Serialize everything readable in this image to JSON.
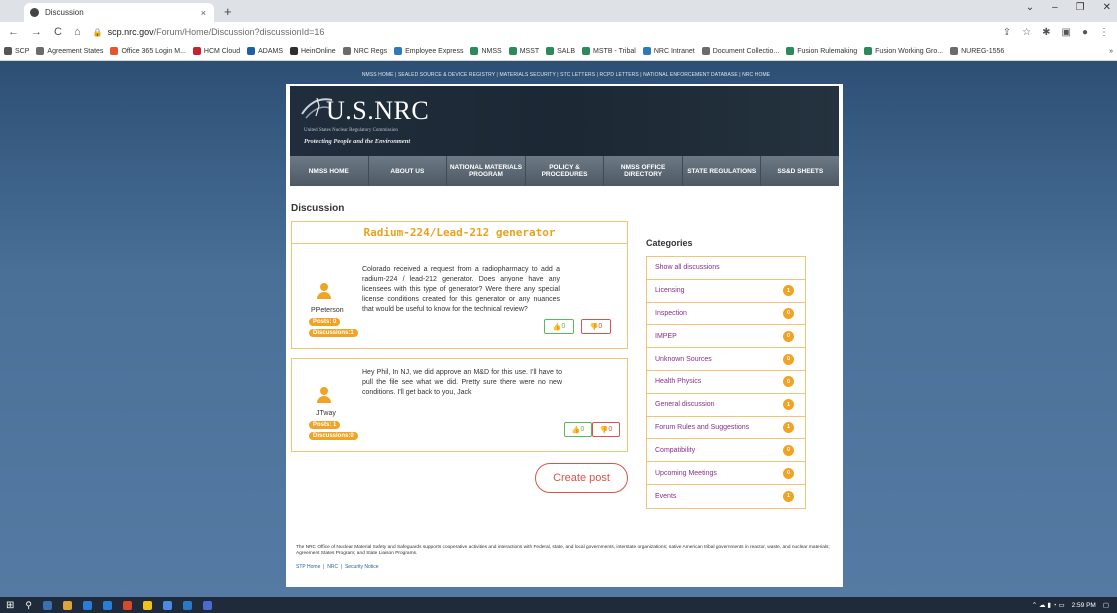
{
  "browser": {
    "tab_title": "Discussion",
    "tab_close": "×",
    "new_tab": "+",
    "win_controls": [
      "⌄",
      "–",
      "❐",
      "✕"
    ],
    "url_host": "scp.nrc.gov",
    "url_path": "/Forum/Home/Discussion?discussionId=16",
    "nav": [
      "←",
      "→",
      "C",
      "⌂"
    ],
    "addr_icons": [
      "⇪",
      "☆",
      "✱",
      "▣",
      "●",
      "⋮"
    ]
  },
  "bookmarks": [
    {
      "label": "SCP",
      "color": "#555555"
    },
    {
      "label": "Agreement States",
      "color": "#6b6b6b"
    },
    {
      "label": "Office 365 Login M...",
      "color": "#e6532d"
    },
    {
      "label": "HCM Cloud",
      "color": "#c8202f"
    },
    {
      "label": "ADAMS",
      "color": "#1f5fa8"
    },
    {
      "label": "HeinOnline",
      "color": "#2e2e2e"
    },
    {
      "label": "NRC Regs",
      "color": "#6b6b6b"
    },
    {
      "label": "Employee Express",
      "color": "#2f7ab8"
    },
    {
      "label": "NMSS",
      "color": "#2a8a5a"
    },
    {
      "label": "MSST",
      "color": "#2a8a5a"
    },
    {
      "label": "SALB",
      "color": "#2a8a5a"
    },
    {
      "label": "MSTB - Tribal",
      "color": "#2a8a5a"
    },
    {
      "label": "NRC Intranet",
      "color": "#2f7ab8"
    },
    {
      "label": "Document Collectio...",
      "color": "#6b6b6b"
    },
    {
      "label": "Fusion Rulemaking",
      "color": "#2a8a5a"
    },
    {
      "label": "Fusion Working Gro...",
      "color": "#2a8a5a"
    },
    {
      "label": "NUREG-1556",
      "color": "#6b6b6b"
    }
  ],
  "bookmark_more": "»",
  "toplinks": "NMSS HOME  |  SEALED SOURCE & DEVICE REGISTRY  |  MATERIALS SECURITY  |  STC LETTERS  |  RCPD LETTERS  |  NATIONAL ENFORCEMENT DATABASE  |  NRC HOME",
  "banner": {
    "logo": "U.S.NRC",
    "subtitle": "United States Nuclear Regulatory Commission",
    "tagline": "Protecting People and the Environment"
  },
  "mainnav": [
    "NMSS HOME",
    "ABOUT US",
    "NATIONAL MATERIALS PROGRAM",
    "POLICY & PROCEDURES",
    "NMSS OFFICE DIRECTORY",
    "STATE REGULATIONS",
    "SS&D SHEETS"
  ],
  "page_title": "Discussion",
  "discussion": {
    "title": "Radium-224/Lead-212 generator",
    "posts": [
      {
        "user": "PPeterson",
        "posts_badge": "Posts: 0",
        "discussions_badge": "Discussions:1",
        "text": "Colorado received a request from a radiopharmacy to add a radium-224 / lead-212 generator. Does anyone have any licensees with this type of generator? Were there any special license conditions created for this generator or any nuances that would be useful to know for the technical review?",
        "likes": "0",
        "dislikes": "0"
      },
      {
        "user": "JTway",
        "posts_badge": "Posts: 1",
        "discussions_badge": "Discussions:0",
        "text": "Hey Phil, In NJ, we did approve an M&D for this use. I'll have to pull the file see what we did. Pretty sure there were no new conditions. I'll get back to you, Jack",
        "likes": "0",
        "dislikes": "0"
      }
    ],
    "like_icon": "👍",
    "dislike_icon": "👎"
  },
  "create_post": "Create post",
  "categories": {
    "title": "Categories",
    "items": [
      {
        "label": "Show all discussions",
        "count": ""
      },
      {
        "label": "Licensing",
        "count": "1"
      },
      {
        "label": "Inspection",
        "count": "0"
      },
      {
        "label": "IMPEP",
        "count": "0"
      },
      {
        "label": "Unknown Sources",
        "count": "0"
      },
      {
        "label": "Health Physics",
        "count": "0"
      },
      {
        "label": "General discussion",
        "count": "1"
      },
      {
        "label": "Forum Rules and Suggestions",
        "count": "1"
      },
      {
        "label": "Compatibility",
        "count": "0"
      },
      {
        "label": "Upcoming Meetings",
        "count": "0"
      },
      {
        "label": "Events",
        "count": "1"
      }
    ]
  },
  "footer": {
    "text": "The NRC Office of Nuclear Material Safety and Safeguards supports cooperative activities and interactions with Federal, state, and local governments, interstate organizations; native American tribal governments in reactor, waste, and nuclear materials; Agreement States Program; and State Liaison Programs.",
    "links": [
      "STP Home",
      "NRC",
      "Security Notice"
    ]
  },
  "taskbar": {
    "start": "⊞",
    "apps": [
      "#3a6fb0",
      "#e0a53a",
      "#2b7cd3",
      "#2b7cd3",
      "#d64c2a",
      "#f0c419",
      "#4b8be0",
      "#2b79c2",
      "#4a6bd0"
    ],
    "time": "2:59 PM"
  }
}
